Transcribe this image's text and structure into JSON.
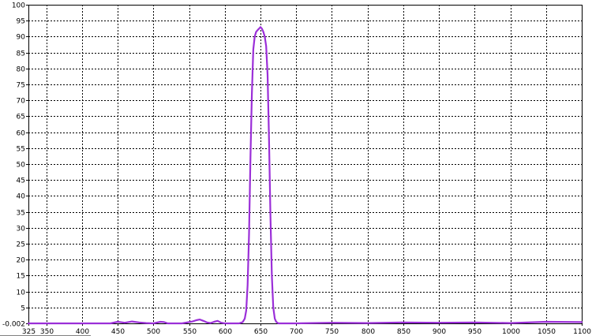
{
  "chart_data": {
    "type": "line",
    "title": "",
    "xlabel": "",
    "ylabel": "",
    "xlim": [
      325,
      1100
    ],
    "ylim": [
      -0.002,
      100
    ],
    "grid": true,
    "legend": "none",
    "x_tick_labels": [
      "325",
      "350",
      "400",
      "450",
      "500",
      "550",
      "600",
      "650",
      "700",
      "750",
      "800",
      "850",
      "900",
      "950",
      "1000",
      "1050",
      "1100"
    ],
    "y_tick_labels": [
      "-0.002",
      "5",
      "10",
      "15",
      "20",
      "25",
      "30",
      "35",
      "40",
      "45",
      "50",
      "55",
      "60",
      "65",
      "70",
      "75",
      "80",
      "85",
      "90",
      "95",
      "100"
    ],
    "series": [
      {
        "color": "#9b2fd8",
        "x": [
          325,
          440,
          450,
          460,
          470,
          480,
          490,
          500,
          510,
          515,
          520,
          540,
          555,
          560,
          565,
          570,
          575,
          580,
          585,
          590,
          595,
          600,
          610,
          620,
          625,
          628,
          630,
          632,
          634,
          636,
          638,
          640,
          642,
          644,
          646,
          648,
          650,
          652,
          654,
          656,
          658,
          660,
          662,
          664,
          666,
          668,
          670,
          672,
          675,
          680,
          700,
          750,
          800,
          850,
          900,
          950,
          1000,
          1050,
          1100
        ],
        "y": [
          0,
          0,
          0.5,
          0.2,
          0.6,
          0.3,
          0.1,
          0,
          0.5,
          0.4,
          0,
          0,
          0.6,
          1,
          1.2,
          0.8,
          0.3,
          0.1,
          0.5,
          0.8,
          0.2,
          0,
          0,
          0,
          0.4,
          1.5,
          4,
          12,
          28,
          52,
          72,
          86,
          90,
          91.5,
          92,
          92.5,
          93,
          92.5,
          91.5,
          90,
          87,
          78,
          58,
          34,
          15,
          5,
          1.5,
          0.5,
          0,
          0,
          0,
          0.2,
          0.1,
          0.3,
          0.2,
          0.3,
          0.1,
          0.5,
          0.4
        ]
      }
    ]
  }
}
